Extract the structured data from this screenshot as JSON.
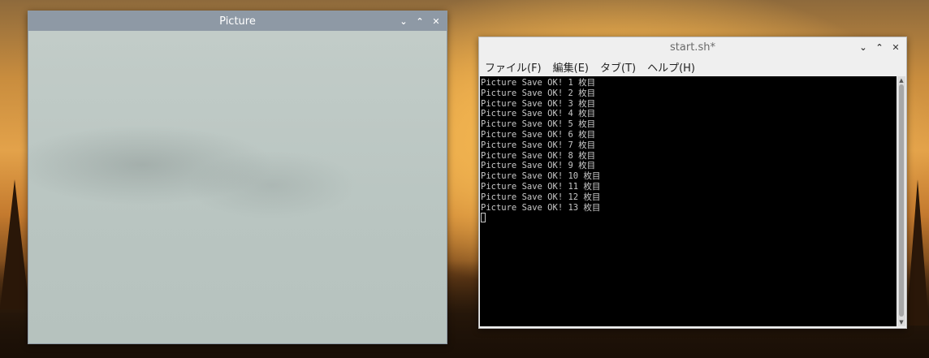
{
  "picture_window": {
    "title": "Picture",
    "controls": {
      "minimize": "⌄",
      "maximize": "⌃",
      "close": "✕"
    }
  },
  "terminal_window": {
    "title": "start.sh*",
    "controls": {
      "minimize": "⌄",
      "maximize": "⌃",
      "close": "✕"
    },
    "menu": [
      "ファイル(F)",
      "編集(E)",
      "タブ(T)",
      "ヘルプ(H)"
    ],
    "lines": [
      "Picture Save OK! 1 枚目",
      "Picture Save OK! 2 枚目",
      "Picture Save OK! 3 枚目",
      "Picture Save OK! 4 枚目",
      "Picture Save OK! 5 枚目",
      "Picture Save OK! 6 枚目",
      "Picture Save OK! 7 枚目",
      "Picture Save OK! 8 枚目",
      "Picture Save OK! 9 枚目",
      "Picture Save OK! 10 枚目",
      "Picture Save OK! 11 枚目",
      "Picture Save OK! 12 枚目",
      "Picture Save OK! 13 枚目"
    ]
  }
}
